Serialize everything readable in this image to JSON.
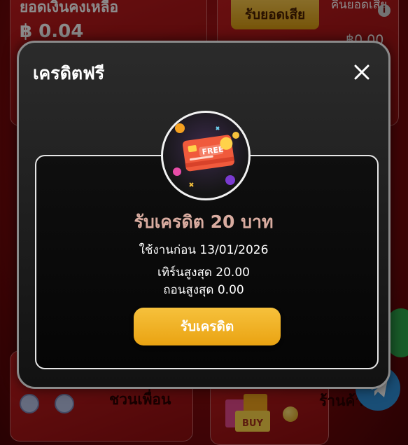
{
  "background": {
    "balance_label": "ยอดเงินคงเหลือ",
    "balance_value": "฿ 0.04",
    "cashback_button": "รับยอดเสีย",
    "loss_label": "คืนยอดเสีย",
    "loss_value": "฿0.00",
    "invite_label": "ชวนเพื่อน",
    "right_label": "ร้านค้า"
  },
  "modal": {
    "title": "เครดิตฟรี",
    "badge_text": "FREE",
    "credit_title": "รับเครดิต 20 บาท",
    "use_before": "ใช้งานก่อน 13/01/2026",
    "max_turnover": "เทิร์นสูงสุด 20.00",
    "max_withdraw": "ถอนสูงสุด 0.00",
    "claim_button": "รับเครดิต"
  },
  "colors": {
    "accent_gold": "#f6c13c",
    "credit_title": "#d9aca0",
    "brand_red": "#b3161a"
  }
}
